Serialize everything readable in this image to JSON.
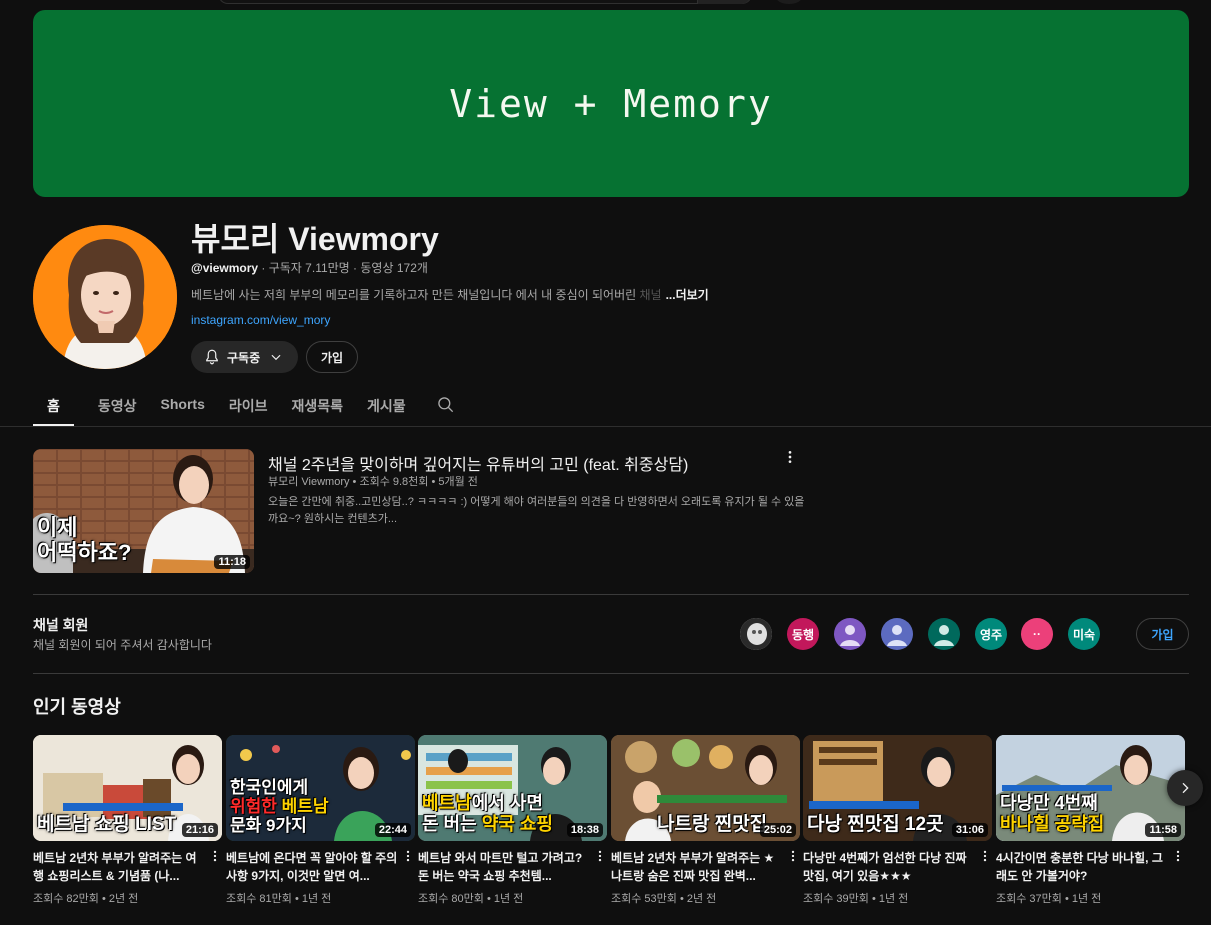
{
  "banner": {
    "text": "View + Memory",
    "color": "#067232"
  },
  "channel": {
    "name": "뷰모리  Viewmory",
    "handle": "@viewmory",
    "stats": " · 구독자 7.11만명 · 동영상 172개",
    "description": "베트남에 사는 저희 부부의 메모리를 기록하고자 만든 채널입니다 에서 내 중심이 되어버린 ",
    "description_fade": "채널",
    "more": "...더보기",
    "link": "instagram.com/view_mory",
    "subscribed_label": "구독중",
    "join_label": "가입"
  },
  "tabs": [
    {
      "label": "홈",
      "active": true
    },
    {
      "label": "동영상"
    },
    {
      "label": "Shorts"
    },
    {
      "label": "라이브"
    },
    {
      "label": "재생목록"
    },
    {
      "label": "게시물"
    }
  ],
  "featured": {
    "title": "채널 2주년을 맞이하며 깊어지는 유튜버의 고민 (feat. 취중상담)",
    "meta": "뷰모리  Viewmory • 조회수 9.8천회 • 5개월 전",
    "description": "오늘은 간만에 취중..고민상담..? ㅋㅋㅋㅋ :) 어떻게 해야 여러분들의 의견을 다 반영하면서 오래도록 유지가 될 수 있을까요~? 원하시는 컨텐츠가...",
    "duration": "11:18",
    "overlay_line1": "이제",
    "overlay_line2": "어떡하죠?"
  },
  "members": {
    "title": "채널 회원",
    "subtitle": "채널 회원이 되어 주셔서 감사합니다",
    "avatars": [
      {
        "label": "",
        "color": "#cfcfcf",
        "icon": "photo-avatar"
      },
      {
        "label": "동행",
        "color": "#c2185b"
      },
      {
        "label": "",
        "color": "#7e57c2",
        "icon": "person-icon"
      },
      {
        "label": "",
        "color": "#5c6bc0",
        "icon": "person-icon"
      },
      {
        "label": "",
        "color": "#00695c",
        "icon": "person-icon"
      },
      {
        "label": "영주",
        "color": "#00897b"
      },
      {
        "label": "··",
        "color": "#ec407a"
      },
      {
        "label": "미숙",
        "color": "#00897b"
      }
    ],
    "join_label": "가입"
  },
  "popular": {
    "title": "인기 동영상",
    "videos": [
      {
        "title": "베트남 2년차 부부가 알려주는 여행 쇼핑리스트 & 기념품 (나...",
        "meta": "조회수 82만회 • 2년 전",
        "duration": "21:16",
        "overlay": "베트남 쇼핑 LIST",
        "bg": "#e9e2d4"
      },
      {
        "title": "베트남에 온다면 꼭 알아야 할 주의사항 9가지, 이것만 알면 여...",
        "meta": "조회수 81만회 • 1년 전",
        "duration": "22:44",
        "overlay1": "한국인에게",
        "overlay2a": "위험한",
        "overlay2b": " 베트남",
        "overlay3": "문화 9가지",
        "bg": "#2f5a2f"
      },
      {
        "title": "베트남 와서 마트만 털고 가려고? 돈 버는 약국 쇼핑 추천템...",
        "meta": "조회수 80만회 • 1년 전",
        "duration": "18:38",
        "overlay1a": "베트남",
        "overlay1b": "에서 사면",
        "overlay2a": "돈 버는 ",
        "overlay2b": "약국 쇼핑",
        "bg": "#6c8e86"
      },
      {
        "title": "베트남 2년차 부부가 알려주는 ★나트랑 숨은 진짜 맛집 완벽...",
        "meta": "조회수 53만회 • 2년 전",
        "duration": "25:02",
        "overlay": "나트랑 찐맛집",
        "bg": "#8a6a4a"
      },
      {
        "title": "다낭만 4번째가 엄선한 다낭 진짜 맛집, 여기 있음★★★",
        "meta": "조회수 39만회 • 1년 전",
        "duration": "31:06",
        "overlay": "다낭 찐맛집 12곳",
        "bg": "#4a3422"
      },
      {
        "title": "4시간이면 충분한 다낭 바나힐, 그래도 안 가볼거야?",
        "meta": "조회수 37만회 • 1년 전",
        "duration": "11:58",
        "overlay1": "다낭만 4번째",
        "overlay2": "바나힐 공략집",
        "bg": "#b8c8d8"
      }
    ]
  }
}
